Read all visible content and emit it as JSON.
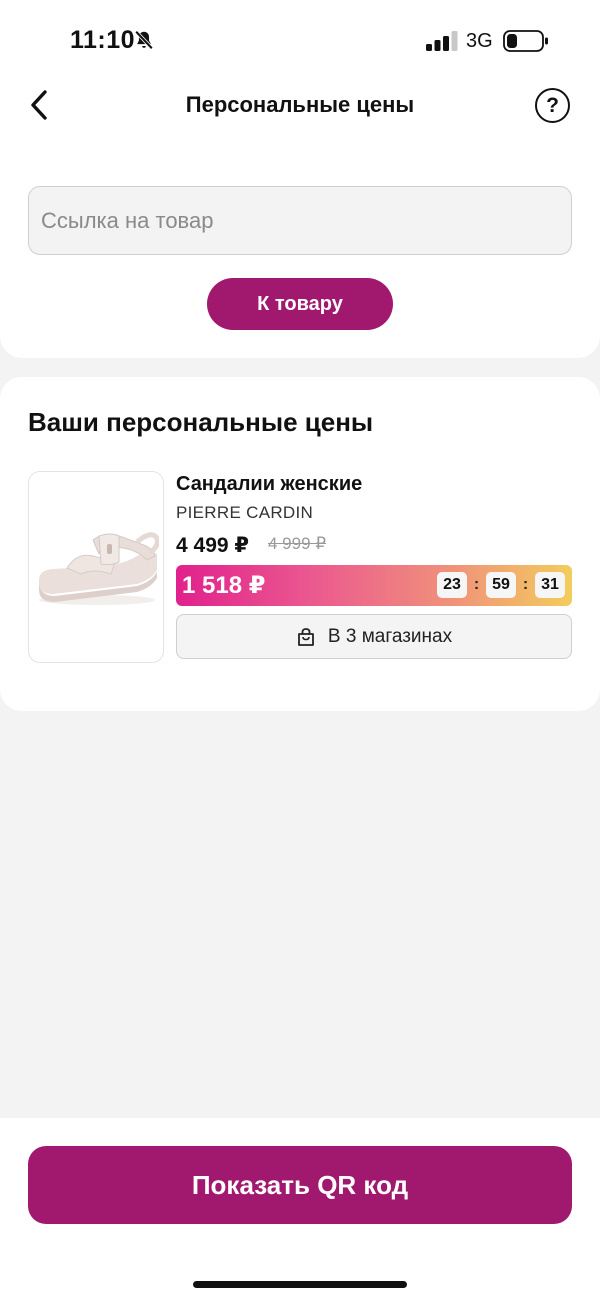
{
  "status_bar": {
    "time": "11:10",
    "network": "3G"
  },
  "header": {
    "title": "Персональные цены"
  },
  "search": {
    "placeholder": "Ссылка на товар",
    "button_label": "К товару"
  },
  "personal_prices": {
    "title": "Ваши персональные цены",
    "items": [
      {
        "name": "Сандалии женские",
        "brand": "PIERRE CARDIN",
        "price": "4 499 ₽",
        "old_price": "4 999 ₽",
        "personal_price": "1 518 ₽",
        "timer": {
          "hours": "23",
          "minutes": "59",
          "seconds": "31"
        },
        "stores_label": "В 3 магазинах"
      }
    ]
  },
  "footer": {
    "qr_button_label": "Показать QR код"
  },
  "colors": {
    "accent": "#a0196f",
    "gradient_start": "#e1208d",
    "gradient_end": "#f3cd5c"
  },
  "icons": [
    "bell-slash-icon",
    "signal-icon",
    "battery-icon",
    "back-chevron-icon",
    "help-icon",
    "shopping-bag-icon"
  ]
}
